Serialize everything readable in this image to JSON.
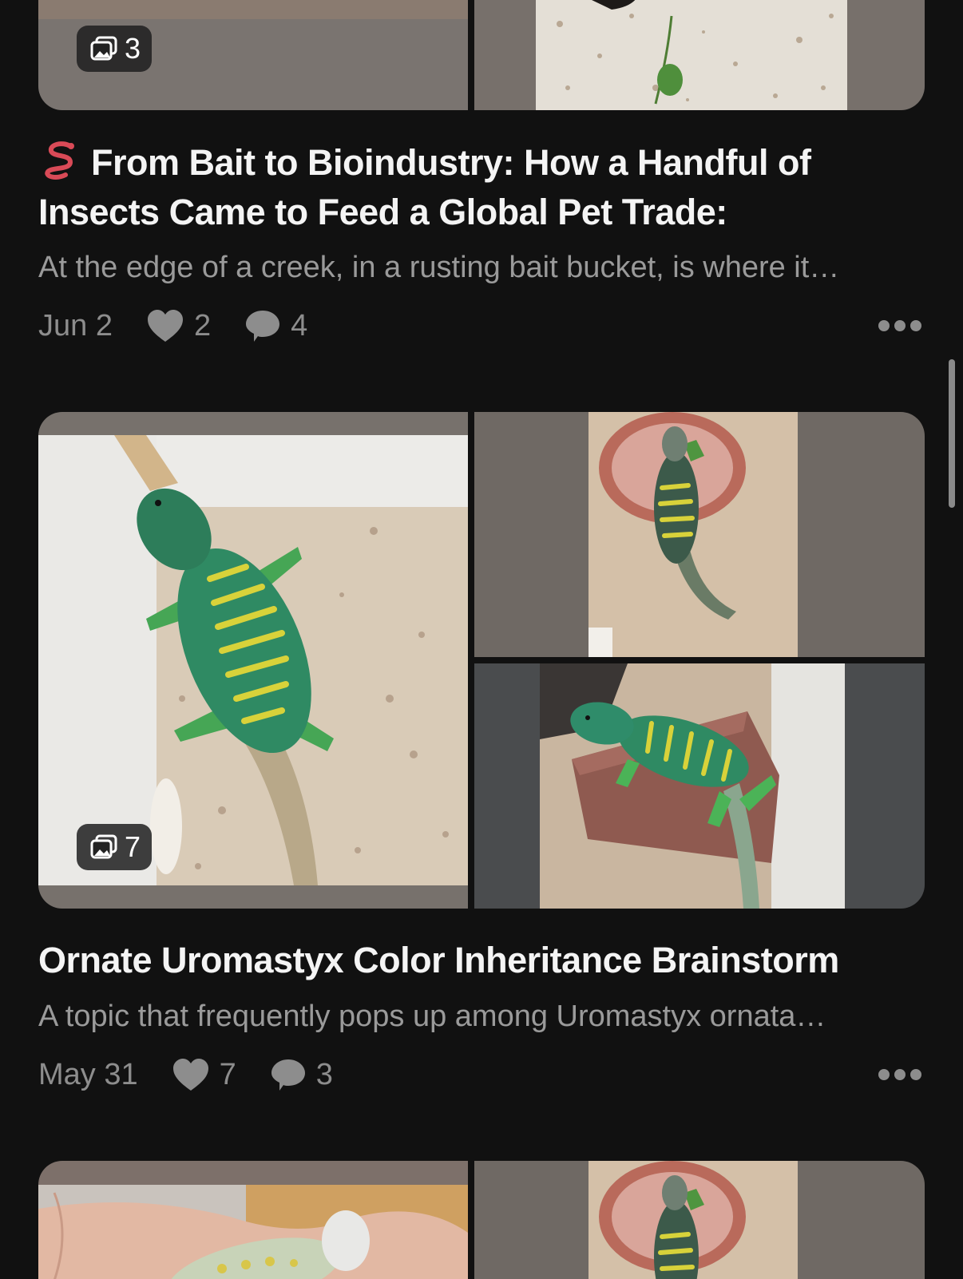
{
  "posts": [
    {
      "photo_count": "3",
      "title_emoji": "worm-icon",
      "title": "From Bait to Bioindustry: How a Handful of Insects Came to Feed a Global Pet Trade:",
      "subtitle": "At the edge of a creek, in a rusting bait bucket, is where it…",
      "date": "Jun 2",
      "likes": "2",
      "comments": "4"
    },
    {
      "photo_count": "7",
      "title": "Ornate Uromastyx Color Inheritance Brainstorm",
      "subtitle": "A topic that frequently pops up among Uromastyx ornata…",
      "date": "May 31",
      "likes": "7",
      "comments": "3"
    }
  ],
  "colors": {
    "background": "#111111",
    "title": "#f4f4f4",
    "secondary_text": "#9a9a9a",
    "lizard_green": "#3f9a4e",
    "lizard_yellow": "#d8d23a"
  }
}
